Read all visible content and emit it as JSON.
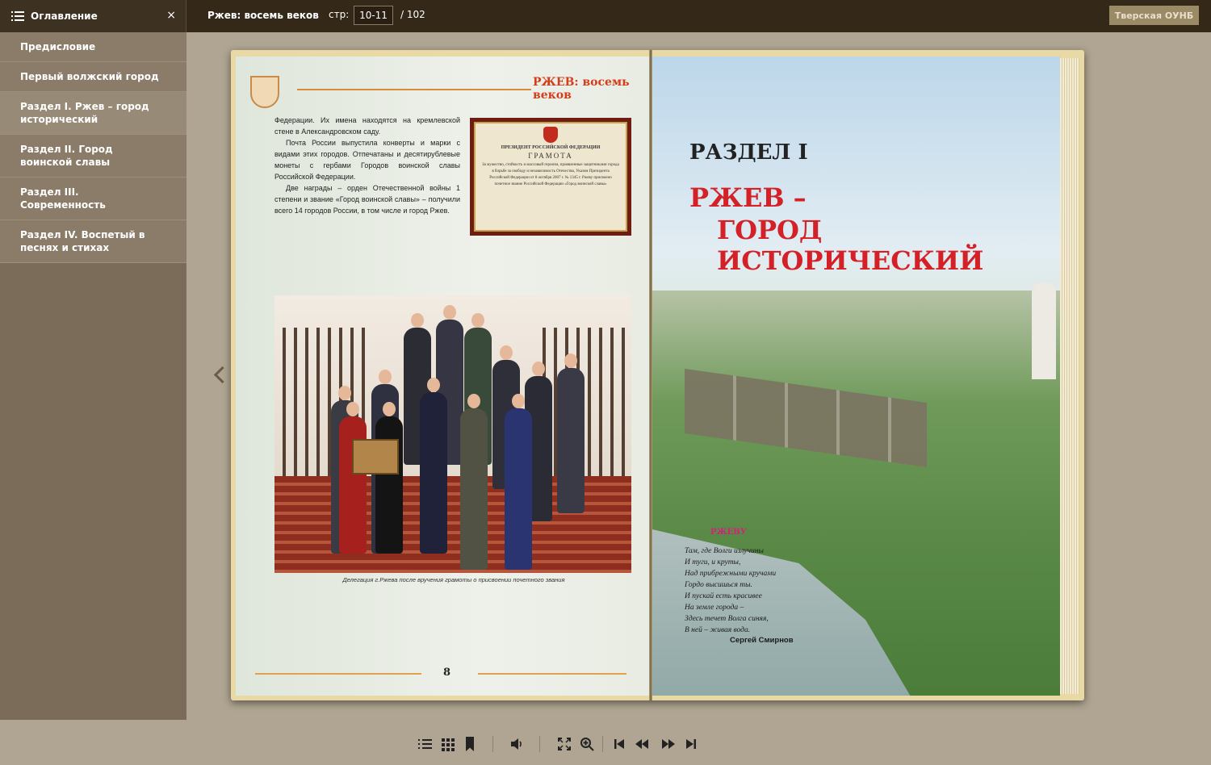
{
  "toc": {
    "title": "Оглавление",
    "close": "×",
    "items": [
      {
        "label": "Предисловие"
      },
      {
        "label": "Первый волжский город"
      },
      {
        "label": "Раздел I. Ржев – город исторический"
      },
      {
        "label": "Раздел II. Город воинской славы"
      },
      {
        "label": "Раздел III. Современность"
      },
      {
        "label": "Раздел IV. Воспетый  в песнях и стихах"
      }
    ]
  },
  "header": {
    "book_title": "Ржев: восемь веков",
    "page_label": "стр:",
    "page_value": "10-11",
    "page_total": "/ 102",
    "org_button": "Тверская ОУНБ"
  },
  "left_page": {
    "running_head": "РЖЕВ: восемь веков",
    "paragraphs": [
      "Федерации. Их имена находятся на кремлевской стене в Александровском саду.",
      "Почта России выпустила конверты и марки с видами этих городов. Отпечатаны и десятирублевые монеты с гербами Городов воинской славы Российской Федерации.",
      "Две награды – орден Отечественной войны 1 степени и звание «Город воинской славы» – получили всего 14 городов России, в том числе и город Ржев."
    ],
    "certificate": {
      "president": "ПРЕЗИДЕНТ РОССИЙСКОЙ ФЕДЕРАЦИИ",
      "title": "ГРАМОТА",
      "text": "За мужество, стойкость и массовый героизм, проявленные защитниками города в борьбе за свободу и независимость Отечества, Указом Президента Российской Федерации от 8 октября 2007 г. № 1345 г. Ржеву присвоено почетное звание Российской Федерации «Город воинской славы»"
    },
    "caption": "Делегация г.Ржева после вручения грамоты о присвоении почетного звания",
    "page_number": "8"
  },
  "right_page": {
    "section_label": "РАЗДЕЛ I",
    "title_line1": "РЖЕВ –",
    "title_line2": "ГОРОД ИСТОРИЧЕСКИЙ",
    "poem_title": "РЖЕВУ",
    "poem_lines": [
      "Там, где Волги излучины",
      "И туги, и круты,",
      "Над прибрежными кручами",
      "Гордо высишься ты.",
      "И пускай есть красивее",
      "На земле города –",
      "Здесь течет Волга синяя,",
      "В ней – живая вода."
    ],
    "poem_author": "Сергей Смирнов"
  },
  "toolbar": {
    "icons": [
      "list-icon",
      "grid-icon",
      "bookmark-icon",
      "volume-icon",
      "fullscreen-icon",
      "zoom-icon",
      "first-page-icon",
      "prev-page-icon",
      "next-page-icon",
      "last-page-icon"
    ]
  },
  "colors": {
    "topbar": "#342818",
    "sidebar": "#7a6c58",
    "background": "#b0a592",
    "accent_red": "#d42128"
  }
}
